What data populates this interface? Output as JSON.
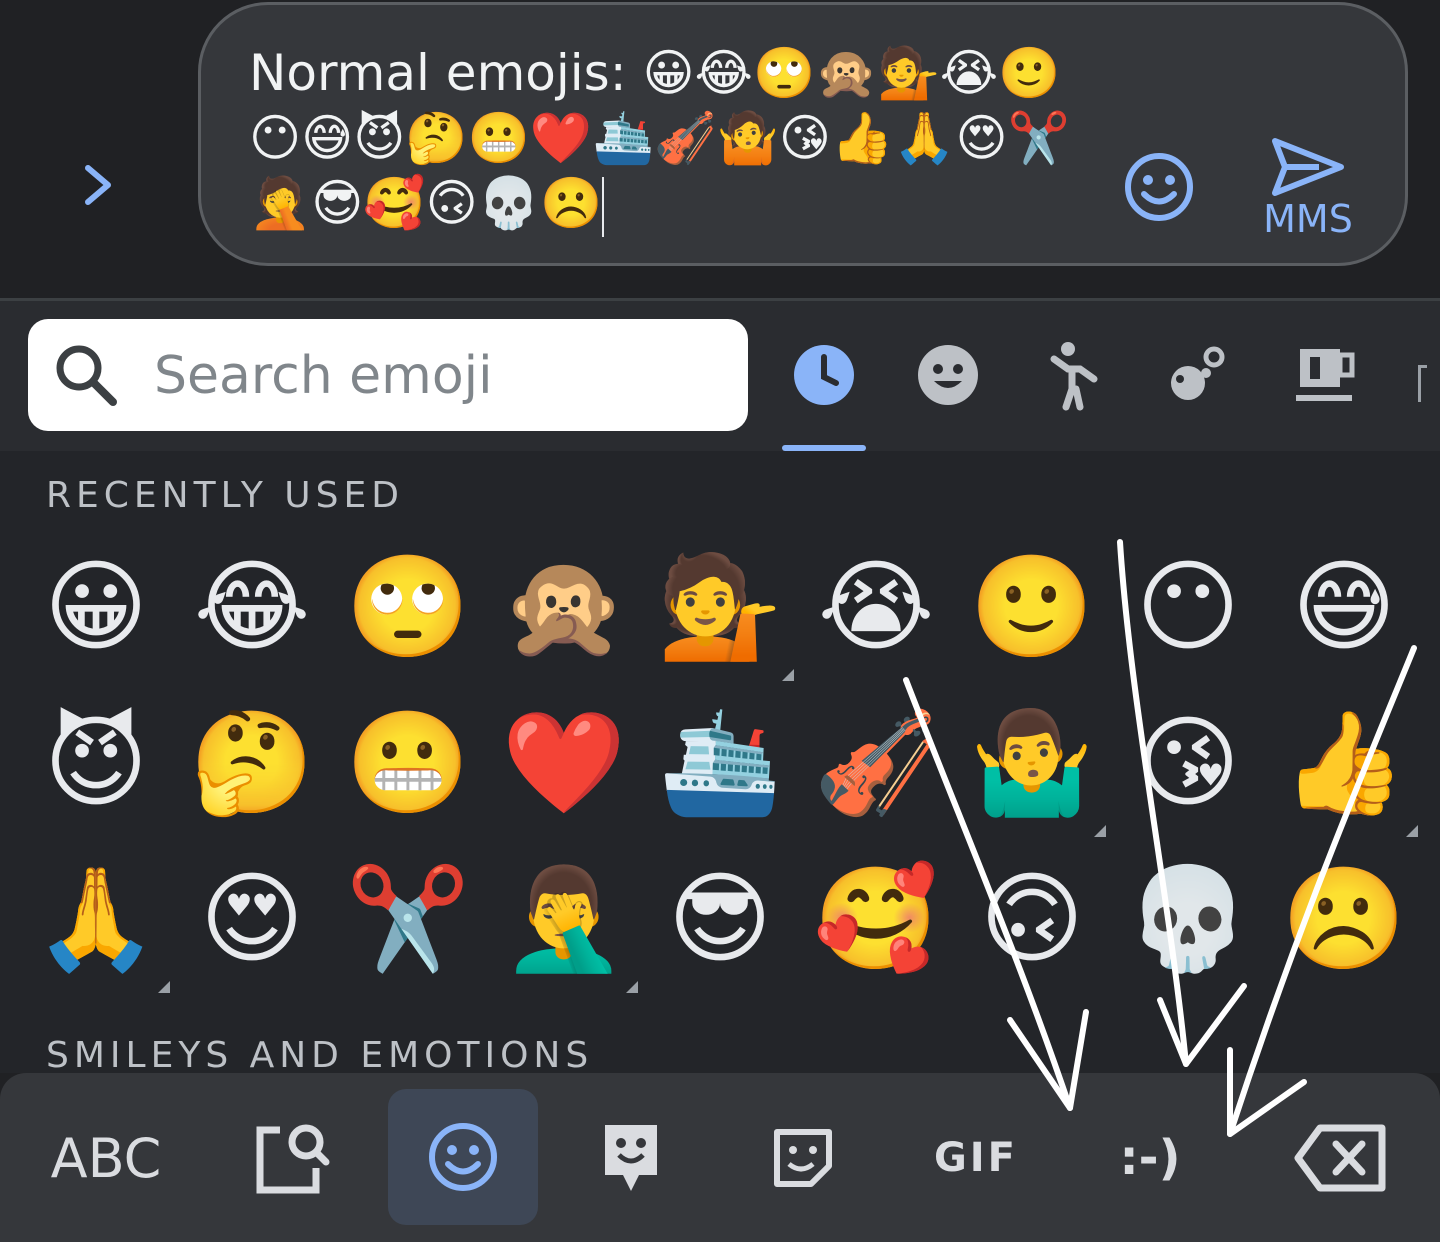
{
  "composer": {
    "message_prefix": "Normal emojis: ",
    "message_emojis": [
      "😀",
      "😂",
      "🙄",
      "🙊",
      "💁",
      "😭",
      "🙂",
      "😶",
      "😅",
      "😈",
      "🤔",
      "😬",
      "❤️",
      "🛳️",
      "🎻",
      "🤷",
      "😘",
      "👍",
      "🙏",
      "😍",
      "✂️",
      "🤦",
      "😎",
      "🥰",
      "🙃",
      "💀",
      "☹️"
    ],
    "send_label": "MMS"
  },
  "search": {
    "placeholder": "Search emoji"
  },
  "category_tabs": [
    "recent-clock-icon",
    "smiley-icon",
    "person-icon",
    "animals-nature-icon",
    "food-drink-icon"
  ],
  "sections": {
    "recent_title": "RECENTLY USED",
    "smileys_title": "SMILEYS AND EMOTIONS"
  },
  "recent_emojis": [
    [
      "😀",
      "😂",
      "🙄",
      "🙊",
      "💁",
      "😭",
      "🙂",
      "😶",
      "😅"
    ],
    [
      "😈",
      "🤔",
      "😬",
      "❤️",
      "🛳️",
      "🎻",
      "🤷‍♂️",
      "😘",
      "👍"
    ],
    [
      "🙏",
      "😍",
      "✂️",
      "🤦‍♂️",
      "😎",
      "🥰",
      "🙃",
      "💀",
      "☹️"
    ]
  ],
  "bottom_bar": {
    "abc_label": "ABC",
    "gif_label": "GIF",
    "emoticon_label": ":-)"
  },
  "colors": {
    "accent": "#8ab4f8",
    "background": "#202124",
    "panel": "#232529",
    "bar": "#35373b"
  }
}
